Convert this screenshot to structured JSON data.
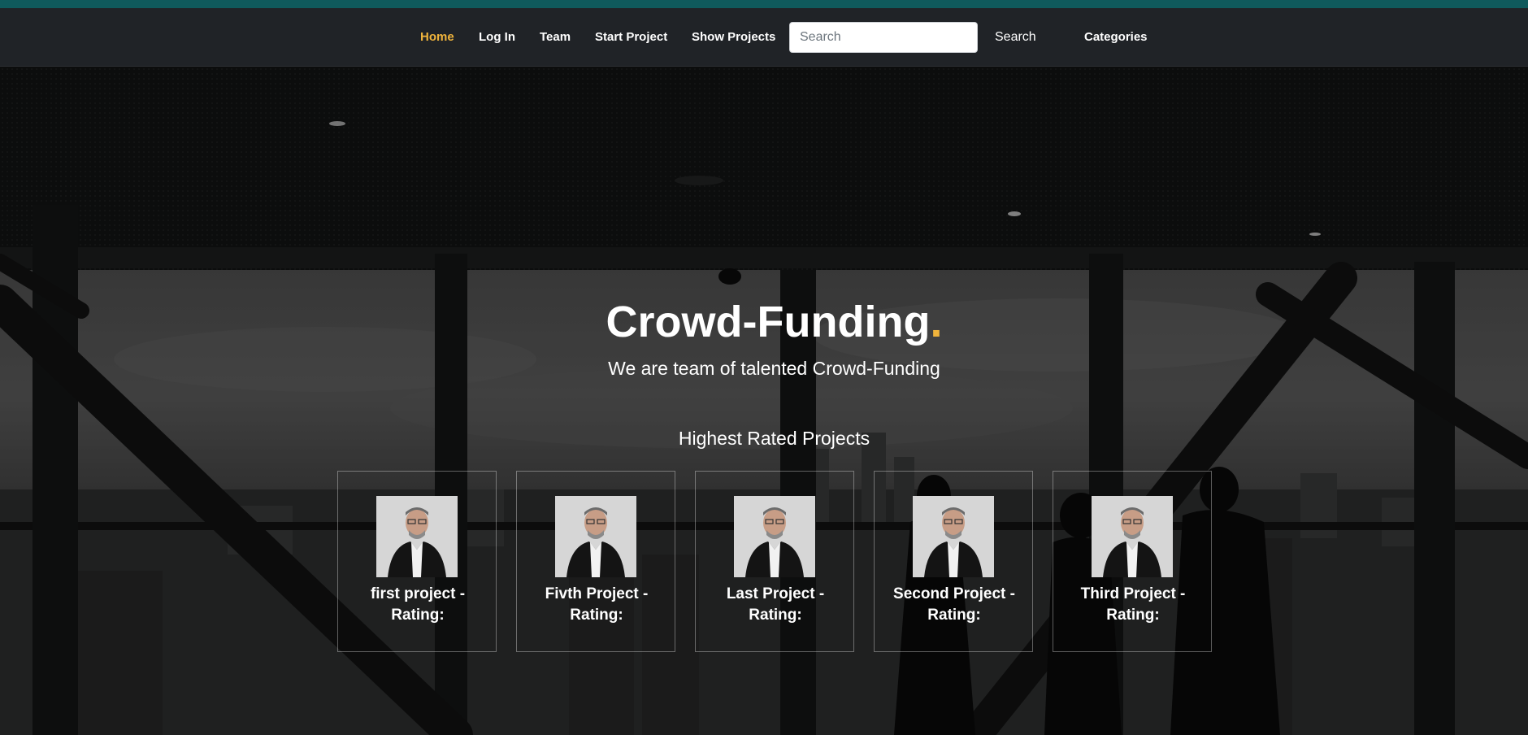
{
  "nav": {
    "items": [
      {
        "label": "Home",
        "active": true
      },
      {
        "label": "Log In",
        "active": false
      },
      {
        "label": "Team",
        "active": false
      },
      {
        "label": "Start Project",
        "active": false
      },
      {
        "label": "Show Projects",
        "active": false
      }
    ],
    "search": {
      "placeholder": "Search",
      "value": "",
      "button_label": "Search"
    },
    "categories_label": "Categories"
  },
  "hero": {
    "title": "Crowd-Funding",
    "title_dot": ".",
    "subtitle": "We are team of talented Crowd-Funding"
  },
  "highest_rated": {
    "heading": "Highest Rated Projects",
    "projects": [
      {
        "title": "first project - Rating:"
      },
      {
        "title": "Fivth Project - Rating:"
      },
      {
        "title": "Last Project - Rating:"
      },
      {
        "title": "Second Project - Rating:"
      },
      {
        "title": "Third Project - Rating:"
      }
    ]
  },
  "colors": {
    "accent": "#f0b43c",
    "navbar": "#202327",
    "top_strip": "#0f5a5c"
  }
}
